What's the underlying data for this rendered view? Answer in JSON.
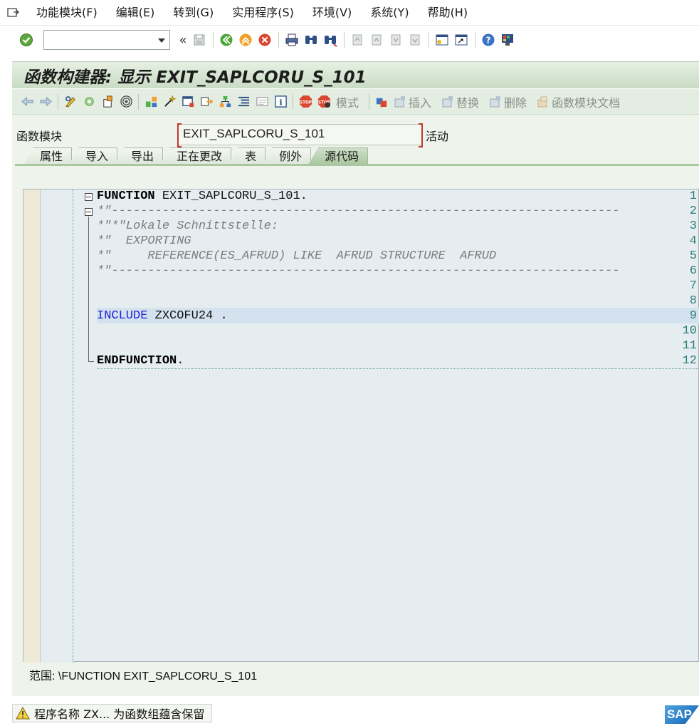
{
  "menu": [
    {
      "label": "功能模块(F)"
    },
    {
      "label": "编辑(E)"
    },
    {
      "label": "转到(G)"
    },
    {
      "label": "实用程序(S)"
    },
    {
      "label": "环境(V)"
    },
    {
      "label": "系统(Y)"
    },
    {
      "label": "帮助(H)"
    }
  ],
  "command_field": {
    "value": ""
  },
  "title": "函数构建器: 显示 EXIT_SAPLCORU_S_101",
  "app_toolbar": {
    "pattern": "模式",
    "insert": "插入",
    "replace": "替换",
    "delete": "删除",
    "fm_doc": "函数模块文档"
  },
  "function_module": {
    "label": "函数模块",
    "value": "EXIT_SAPLCORU_S_101",
    "status": "活动"
  },
  "tabs": [
    "属性",
    "导入",
    "导出",
    "正在更改",
    "表",
    "例外",
    "源代码"
  ],
  "active_tab": "源代码",
  "code_lines": [
    {
      "n": "1",
      "kw": "FUNCTION",
      "rest": " EXIT_SAPLCORU_S_101."
    },
    {
      "n": "2",
      "text": "*\"----------------------------------------------------------------------"
    },
    {
      "n": "3",
      "text": "*\"*\"Lokale Schnittstelle:"
    },
    {
      "n": "4",
      "text": "*\"  EXPORTING"
    },
    {
      "n": "5",
      "text": "*\"     REFERENCE(ES_AFRUD) LIKE  AFRUD STRUCTURE  AFRUD"
    },
    {
      "n": "6",
      "text": "*\"----------------------------------------------------------------------"
    },
    {
      "n": "7"
    },
    {
      "n": "8"
    },
    {
      "n": "9",
      "kw": "INCLUDE",
      "rest": " ZXCOFU24 ."
    },
    {
      "n": "10"
    },
    {
      "n": "11"
    },
    {
      "n": "12",
      "kw": "ENDFUNCTION",
      "rest": "."
    }
  ],
  "scope": "范围:  \\FUNCTION EXIT_SAPLCORU_S_101",
  "status_message": "程序名称 ZX... 为函数组蕴含保留",
  "sap_logo": "SAP",
  "colors": {
    "title_bg": "#c9dcc4",
    "keyword_blue": "#1f1fd6",
    "comment": "#7c7c7c",
    "line_number": "#2f7d7d"
  }
}
